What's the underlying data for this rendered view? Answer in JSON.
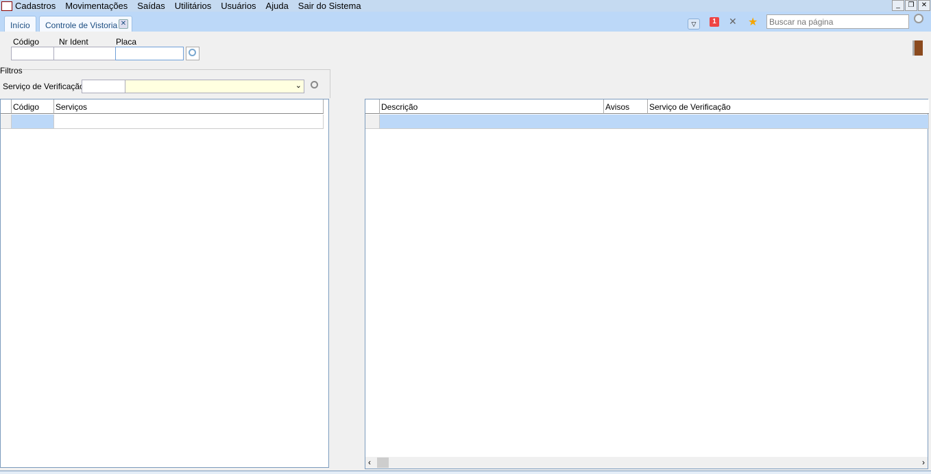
{
  "menu": [
    "Cadastros",
    "Movimentações",
    "Saídas",
    "Utilitários",
    "Usuários",
    "Ajuda",
    "Sair do Sistema"
  ],
  "window_buttons": {
    "minimize": "_",
    "restore": "❐",
    "close": "✕"
  },
  "tabs": [
    "Início",
    "Controle de Vistoria"
  ],
  "toolbar": {
    "badge": "1",
    "search_placeholder": "Buscar na página"
  },
  "form": {
    "codigo_label": "Código",
    "nr_ident_label": "Nr Ident",
    "placa_label": "Placa"
  },
  "filters": {
    "title": "Filtros",
    "servico_label": "Serviço de Verificação"
  },
  "left_grid": {
    "columns": [
      "Código",
      "Serviços"
    ]
  },
  "right_grid": {
    "columns": [
      "Descrição",
      "Avisos",
      "Serviço de Verificação"
    ]
  }
}
